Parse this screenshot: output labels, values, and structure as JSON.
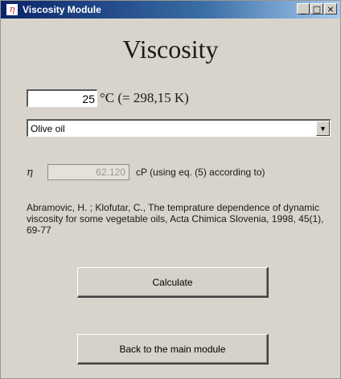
{
  "window": {
    "icon_glyph": "η",
    "title": "Viscosity Module",
    "controls": {
      "minimize": "_",
      "maximize": "□",
      "close": "×"
    }
  },
  "heading": "Viscosity",
  "temperature": {
    "value": "25",
    "unit_text": "°C (= 298,15 K)"
  },
  "substance": {
    "selected": "Olive oil",
    "arrow": "▼"
  },
  "result": {
    "symbol": "η",
    "value": "62.120",
    "note": "cP (using eq. (5) according to)"
  },
  "reference": "Abramovic, H. ; Klofutar, C., The temprature dependence of dynamic viscosity for some vegetable oils, Acta Chimica Slovenia, 1998, 45(1), 69-77",
  "buttons": {
    "calculate": "Calculate",
    "back": "Back to the main module"
  }
}
